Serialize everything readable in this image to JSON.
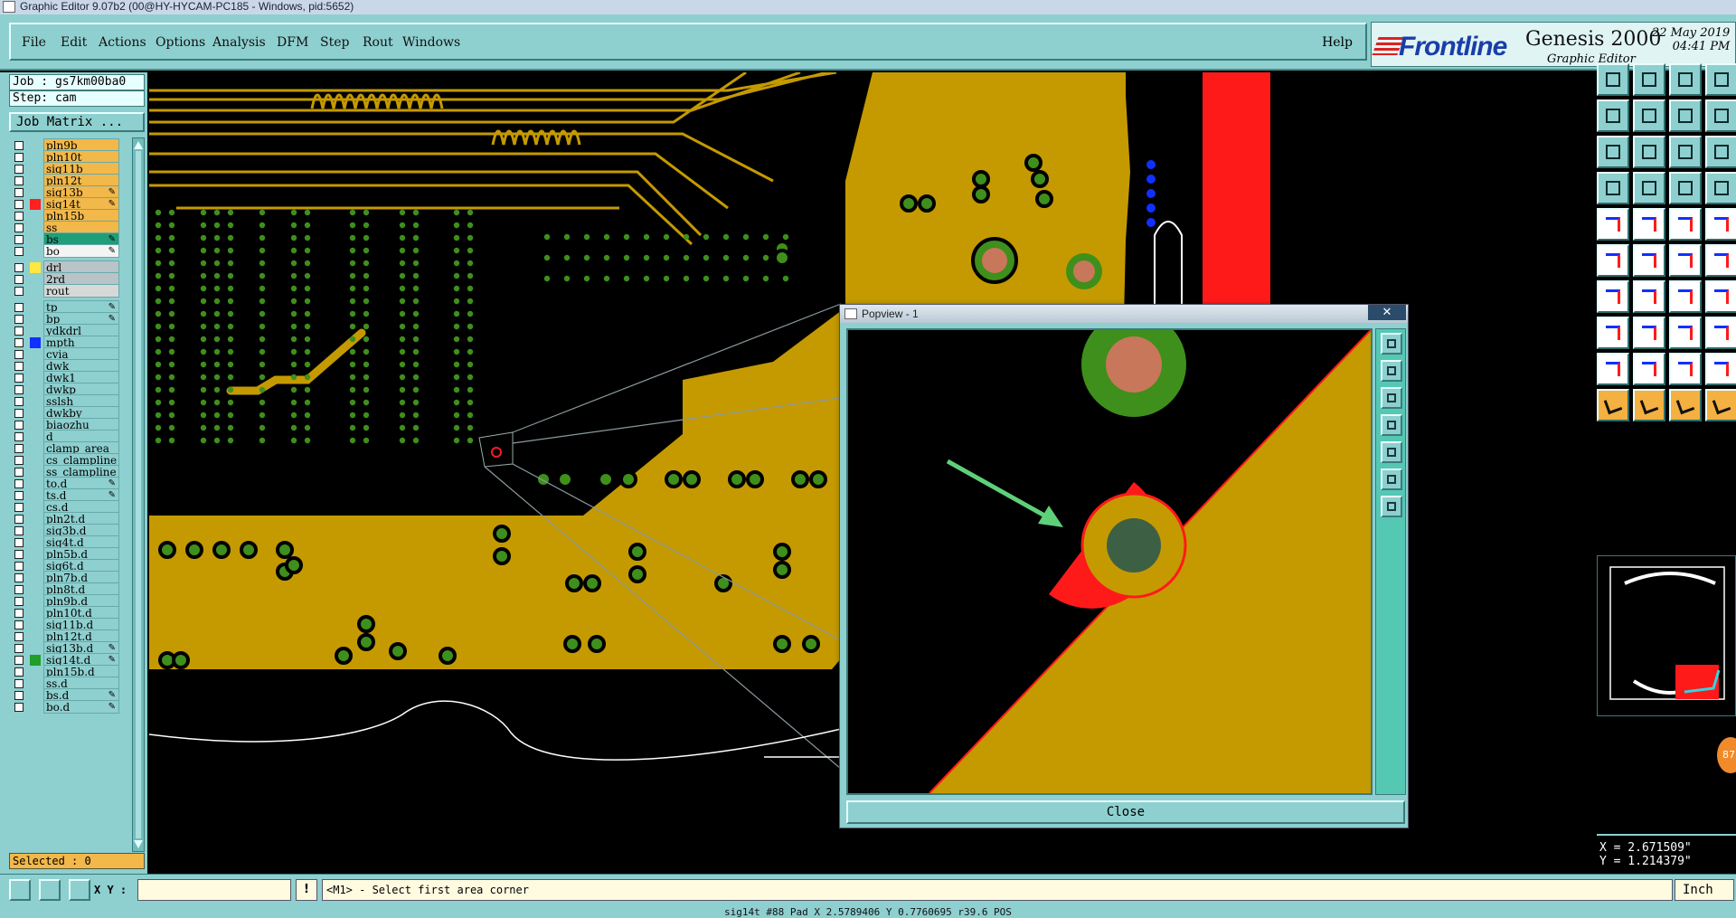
{
  "window": {
    "title": "Graphic Editor 9.07b2 (00@HY-HYCAM-PC185 - Windows, pid:5652)"
  },
  "menu": {
    "items": [
      "File",
      "Edit",
      "Actions",
      "Options",
      "Analysis",
      "DFM",
      "Step",
      "Rout",
      "Windows"
    ],
    "help": "Help"
  },
  "brand": {
    "logo": "Frontline",
    "product": "Genesis 2000",
    "subtitle": "Graphic Editor",
    "date": "22 May 2019",
    "time": "04:41 PM"
  },
  "left": {
    "job_label": "Job : gs7km00ba0",
    "step_label": "Step: cam",
    "job_matrix": "Job Matrix ...",
    "selected": "Selected : 0",
    "layers": [
      {
        "name": "pln9b",
        "bg": "#f2b84a",
        "swatch": "",
        "flag": ""
      },
      {
        "name": "pln10t",
        "bg": "#f2b84a",
        "swatch": "",
        "flag": ""
      },
      {
        "name": "sig11b",
        "bg": "#f2b84a",
        "swatch": "",
        "flag": ""
      },
      {
        "name": "pln12t",
        "bg": "#f2b84a",
        "swatch": "",
        "flag": ""
      },
      {
        "name": "sig13b",
        "bg": "#f2b84a",
        "swatch": "",
        "flag": "✎"
      },
      {
        "name": "sig14t",
        "bg": "#f2b84a",
        "swatch": "#ff2020",
        "flag": "✎"
      },
      {
        "name": "pln15b",
        "bg": "#f2b84a",
        "swatch": "",
        "flag": ""
      },
      {
        "name": "ss",
        "bg": "#f2b84a",
        "swatch": "",
        "flag": ""
      },
      {
        "name": "bs",
        "bg": "#1f9e7a",
        "swatch": "",
        "flag": "✎"
      },
      {
        "name": "bo",
        "bg": "#f4f4f4",
        "swatch": "",
        "flag": "✎"
      },
      {
        "name": "drl",
        "bg": "#b9c4c8",
        "swatch": "#ffe840",
        "flag": "",
        "gap": true
      },
      {
        "name": "2rd",
        "bg": "#b9c4c8",
        "swatch": "",
        "flag": ""
      },
      {
        "name": "rout",
        "bg": "#d8d8d8",
        "swatch": "",
        "flag": ""
      },
      {
        "name": "tp",
        "bg": "#8ecfcf",
        "swatch": "",
        "flag": "✎",
        "gap": true
      },
      {
        "name": "bp",
        "bg": "#8ecfcf",
        "swatch": "",
        "flag": "✎"
      },
      {
        "name": "ydkdrl",
        "bg": "#8ecfcf",
        "swatch": "",
        "flag": ""
      },
      {
        "name": "mpth",
        "bg": "#8ecfcf",
        "swatch": "#1030ff",
        "flag": ""
      },
      {
        "name": "cvia",
        "bg": "#8ecfcf",
        "swatch": "",
        "flag": ""
      },
      {
        "name": "dwk",
        "bg": "#8ecfcf",
        "swatch": "",
        "flag": ""
      },
      {
        "name": "dwk1",
        "bg": "#8ecfcf",
        "swatch": "",
        "flag": ""
      },
      {
        "name": "dwkp",
        "bg": "#8ecfcf",
        "swatch": "",
        "flag": ""
      },
      {
        "name": "sslsh",
        "bg": "#8ecfcf",
        "swatch": "",
        "flag": ""
      },
      {
        "name": "dwkby",
        "bg": "#8ecfcf",
        "swatch": "",
        "flag": ""
      },
      {
        "name": "biaozhu",
        "bg": "#8ecfcf",
        "swatch": "",
        "flag": ""
      },
      {
        "name": "d",
        "bg": "#8ecfcf",
        "swatch": "",
        "flag": ""
      },
      {
        "name": "clamp_area",
        "bg": "#8ecfcf",
        "swatch": "",
        "flag": ""
      },
      {
        "name": "cs_clampline",
        "bg": "#8ecfcf",
        "swatch": "",
        "flag": ""
      },
      {
        "name": "ss_clampline",
        "bg": "#8ecfcf",
        "swatch": "",
        "flag": ""
      },
      {
        "name": "to.d",
        "bg": "#8ecfcf",
        "swatch": "",
        "flag": "✎"
      },
      {
        "name": "ts.d",
        "bg": "#8ecfcf",
        "swatch": "",
        "flag": "✎"
      },
      {
        "name": "cs.d",
        "bg": "#8ecfcf",
        "swatch": "",
        "flag": ""
      },
      {
        "name": "pln2t.d",
        "bg": "#8ecfcf",
        "swatch": "",
        "flag": ""
      },
      {
        "name": "sig3b.d",
        "bg": "#8ecfcf",
        "swatch": "",
        "flag": ""
      },
      {
        "name": "sig4t.d",
        "bg": "#8ecfcf",
        "swatch": "",
        "flag": ""
      },
      {
        "name": "pln5b.d",
        "bg": "#8ecfcf",
        "swatch": "",
        "flag": ""
      },
      {
        "name": "sig6t.d",
        "bg": "#8ecfcf",
        "swatch": "",
        "flag": ""
      },
      {
        "name": "pln7b.d",
        "bg": "#8ecfcf",
        "swatch": "",
        "flag": ""
      },
      {
        "name": "pln8t.d",
        "bg": "#8ecfcf",
        "swatch": "",
        "flag": ""
      },
      {
        "name": "pln9b.d",
        "bg": "#8ecfcf",
        "swatch": "",
        "flag": ""
      },
      {
        "name": "pln10t.d",
        "bg": "#8ecfcf",
        "swatch": "",
        "flag": ""
      },
      {
        "name": "sig11b.d",
        "bg": "#8ecfcf",
        "swatch": "",
        "flag": ""
      },
      {
        "name": "pln12t.d",
        "bg": "#8ecfcf",
        "swatch": "",
        "flag": ""
      },
      {
        "name": "sig13b.d",
        "bg": "#8ecfcf",
        "swatch": "",
        "flag": "✎"
      },
      {
        "name": "sig14t.d",
        "bg": "#8ecfcf",
        "swatch": "#1f9e2a",
        "flag": "✎"
      },
      {
        "name": "pln15b.d",
        "bg": "#8ecfcf",
        "swatch": "",
        "flag": ""
      },
      {
        "name": "ss.d",
        "bg": "#8ecfcf",
        "swatch": "",
        "flag": ""
      },
      {
        "name": "bs.d",
        "bg": "#8ecfcf",
        "swatch": "",
        "flag": "✎"
      },
      {
        "name": "bo.d",
        "bg": "#8ecfcf",
        "swatch": "",
        "flag": "✎"
      }
    ]
  },
  "popview": {
    "title": "Popview - 1",
    "close_x": "✕",
    "close_button": "Close"
  },
  "right": {
    "coord_x": "X = 2.671509\"",
    "coord_y": "Y = 1.214379\"",
    "badge": "87"
  },
  "cmd": {
    "xy_label": "X Y :",
    "xy_value": "",
    "alert": "!",
    "prompt": "<M1> - Select first area corner",
    "units": "Inch"
  },
  "status": "sig14t #88 Pad X 2.5789406 Y 0.7760695 r39.6 POS",
  "colors": {
    "copper": "#c59a00",
    "pad_green": "#3f8f1c",
    "drill": "#c8775a",
    "highlight": "#ff1a1a",
    "panel": "#8ecfcf"
  }
}
